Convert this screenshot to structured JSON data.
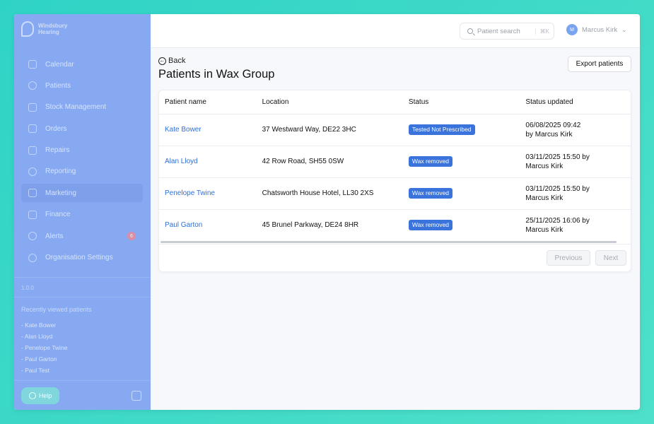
{
  "brand": {
    "line1": "Windsbury",
    "line2": "Hearing"
  },
  "sidebar": {
    "items": [
      {
        "label": "Calendar",
        "icon": "calendar-icon"
      },
      {
        "label": "Patients",
        "icon": "patients-icon"
      },
      {
        "label": "Stock Management",
        "icon": "stock-icon"
      },
      {
        "label": "Orders",
        "icon": "orders-icon"
      },
      {
        "label": "Repairs",
        "icon": "wrench-icon"
      },
      {
        "label": "Reporting",
        "icon": "chart-icon"
      },
      {
        "label": "Marketing",
        "icon": "mail-icon"
      },
      {
        "label": "Finance",
        "icon": "card-icon"
      },
      {
        "label": "Alerts",
        "icon": "bell-icon",
        "badge": "6"
      },
      {
        "label": "Organisation Settings",
        "icon": "gear-icon"
      }
    ],
    "active": "Marketing",
    "version": "1.0.0",
    "recent_title": "Recently viewed patients",
    "recent": [
      "- Kate Bower",
      "- Alan Lloyd",
      "- Penelope Twine",
      "- Paul Garton",
      "- Paul Test"
    ],
    "help_label": "Help"
  },
  "topbar": {
    "search_placeholder": "Patient search",
    "search_shortcut": "⌘K",
    "user_initials": "M",
    "user_name": "Marcus Kirk"
  },
  "page": {
    "back_label": "Back",
    "title": "Patients in Wax Group",
    "export_label": "Export patients"
  },
  "table": {
    "columns": [
      "Patient name",
      "Location",
      "Status",
      "Status updated"
    ],
    "rows": [
      {
        "name": "Kate Bower",
        "location": "37 Westward Way, DE22 3HC",
        "status": "Tested Not Prescribed",
        "updated_line1": "06/08/2025 09:42",
        "updated_line2": "by Marcus Kirk"
      },
      {
        "name": "Alan Lloyd",
        "location": "42 Row Road, SH55 0SW",
        "status": "Wax removed",
        "updated_line1": "03/11/2025 15:50 by",
        "updated_line2": "Marcus Kirk"
      },
      {
        "name": "Penelope Twine",
        "location": "Chatsworth House Hotel, LL30 2XS",
        "status": "Wax removed",
        "updated_line1": "03/11/2025 15:50 by",
        "updated_line2": "Marcus Kirk"
      },
      {
        "name": "Paul Garton",
        "location": "45 Brunel Parkway, DE24 8HR",
        "status": "Wax removed",
        "updated_line1": "25/11/2025 16:06 by",
        "updated_line2": "Marcus Kirk"
      }
    ]
  },
  "pagination": {
    "previous": "Previous",
    "next": "Next"
  },
  "colors": {
    "sidebar": "#86a9f1",
    "accent": "#3a73dc",
    "link": "#2f6fd6",
    "frame": "#2fd3c6"
  }
}
